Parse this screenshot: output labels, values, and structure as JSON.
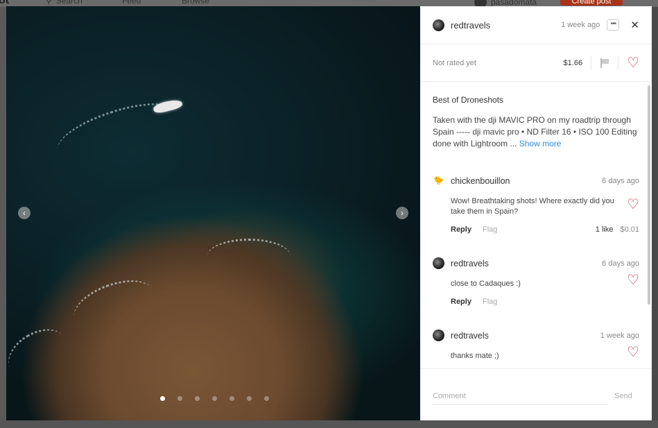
{
  "background": {
    "logo": "ot",
    "search_placeholder": "Search",
    "nav": {
      "feed": "Feed",
      "browse": "Browse"
    },
    "username": "pasadomata",
    "create_post": "Create post"
  },
  "photo": {
    "carousel_count": 7,
    "active_index": 0
  },
  "post": {
    "author": "redtravels",
    "time": "1 week ago",
    "rating": "Not rated yet",
    "price": "$1.66",
    "title": "Best of Droneshots",
    "body": "Taken with the dji MAVIC PRO on my roadtrip through Spain ----- dji mavic pro • ND Filter 16 • ISO 100 Editing done with Lightroom ...",
    "show_more": "Show more"
  },
  "comments": [
    {
      "author": "chickenbouillon",
      "time": "6 days ago",
      "text": "Wow! Breathtaking shots! Where exactly did you take them in Spain?",
      "reply": "Reply",
      "flag": "Flag",
      "likes": "1 like",
      "value": "$0.01"
    },
    {
      "author": "redtravels",
      "time": "6 days ago",
      "text": "close to Cadaques :)",
      "reply": "Reply",
      "flag": "Flag"
    },
    {
      "author": "redtravels",
      "time": "1 week ago",
      "text": "thanks mate ;)"
    }
  ],
  "footer": {
    "comment_placeholder": "Comment",
    "send": "Send"
  },
  "colors": {
    "heart": "#c0283c",
    "link": "#2f8fdc",
    "create_button": "#a8331a"
  }
}
